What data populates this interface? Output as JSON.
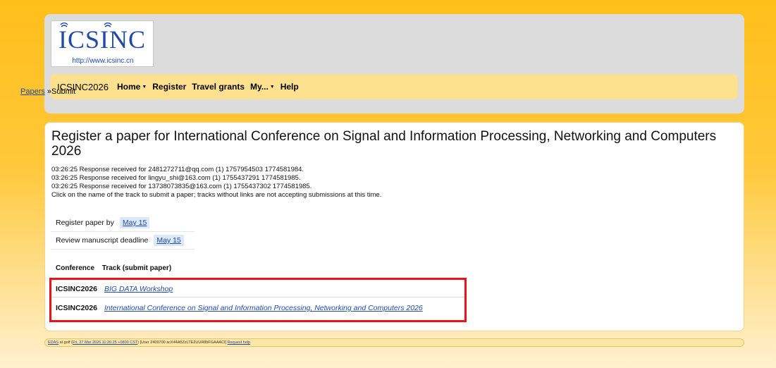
{
  "logo": {
    "text": "ICSINC",
    "url": "http://www.icsinc.cn"
  },
  "nav": {
    "brand": "ICSINC2026",
    "items": [
      {
        "label": "Home",
        "has_menu": true
      },
      {
        "label": "Register",
        "has_menu": false
      },
      {
        "label": "Travel grants",
        "has_menu": false
      },
      {
        "label": "My...",
        "has_menu": true
      },
      {
        "label": "Help",
        "has_menu": false
      }
    ]
  },
  "breadcrumb": {
    "link": "Papers",
    "separator": " »",
    "current": "Submit"
  },
  "page": {
    "title": "Register a paper for International Conference on Signal and Information Processing, Networking and Computers 2026",
    "messages": [
      "03:26:25 Response received for 2481272711@qq.com (1) 1757954503 1774581984.",
      "03:26:25 Response received for lingyu_shi@163.com (1) 1755437291 1774581985.",
      "03:26:25 Response received for 13738073835@163.com (1) 1755437302 1774581985.",
      "Click on the name of the track to submit a paper; tracks without links are not accepting submissions at this time."
    ]
  },
  "deadlines": [
    {
      "label": "Register paper by",
      "value": "May 15"
    },
    {
      "label": "Review manuscript deadline",
      "value": "May 15"
    }
  ],
  "tracks": {
    "col_conference": "Conference",
    "col_track": "Track (submit paper)",
    "rows": [
      {
        "conference": "ICSINC2026",
        "track": "BIG DATA Workshop"
      },
      {
        "conference": "ICSINC2026",
        "track": "International Conference on Signal and Information Processing, Networking and Computers 2026"
      }
    ]
  },
  "footer": {
    "edas": "EDAS",
    "at": " at golf (",
    "timestamp": "Fri, 27 Mar 2026 11:26:25 +0800 CST",
    "user": ") [User 2409700 acX44A5ZzLTE2UUR8bFGAAACI] ",
    "help": "Request help"
  },
  "colors": {
    "highlight": "#e8141a",
    "navbar": "#fee18e",
    "link": "#1f4aa8"
  }
}
